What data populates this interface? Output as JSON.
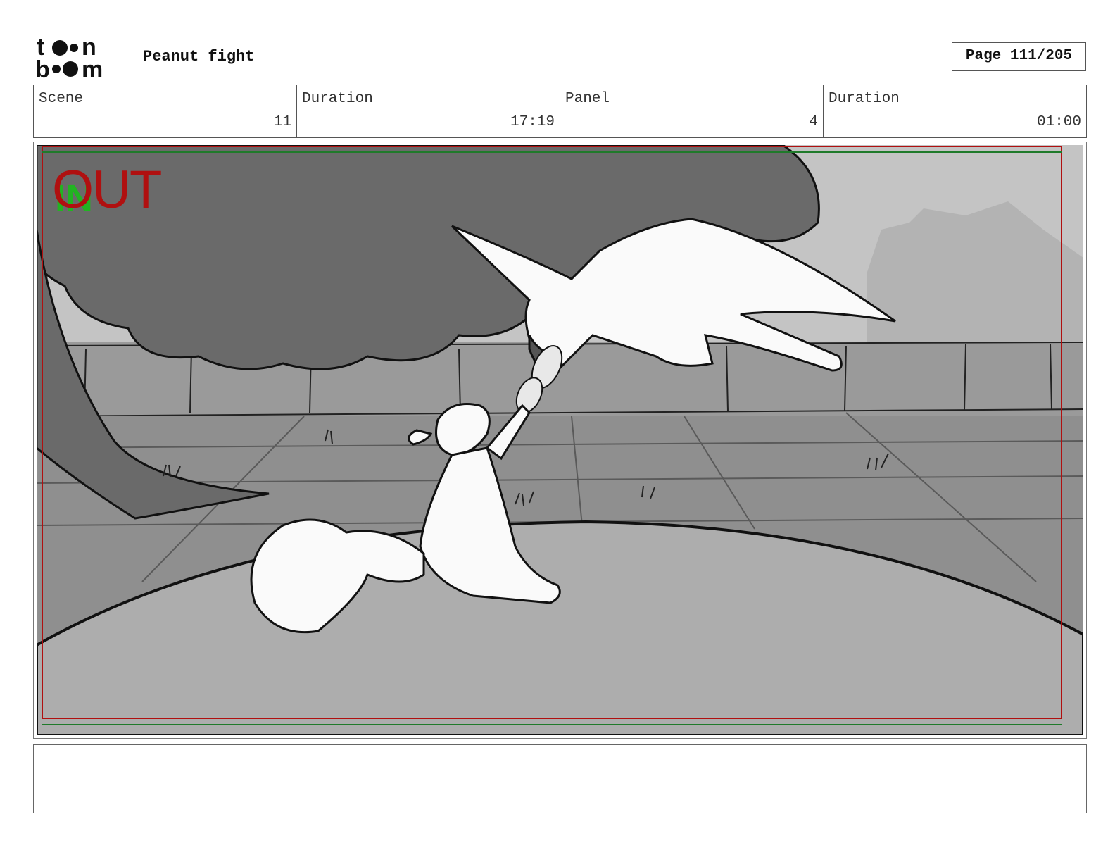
{
  "header": {
    "logo_text": "toon boom",
    "title": "Peanut fight",
    "page_label": "Page 111/205"
  },
  "info": {
    "scene_label": "Scene",
    "scene_value": "11",
    "scene_duration_label": "Duration",
    "scene_duration_value": "17:19",
    "panel_label": "Panel",
    "panel_value": "4",
    "panel_duration_label": "Duration",
    "panel_duration_value": "01:00"
  },
  "panel": {
    "out_marker": "OUT",
    "in_marker": "IN",
    "safe_frame_color": "#b01010",
    "title_safe_color": "#1f7a2a",
    "out_marker_color": "#b01010",
    "in_marker_color": "#22b422"
  },
  "notes": {
    "text": ""
  }
}
